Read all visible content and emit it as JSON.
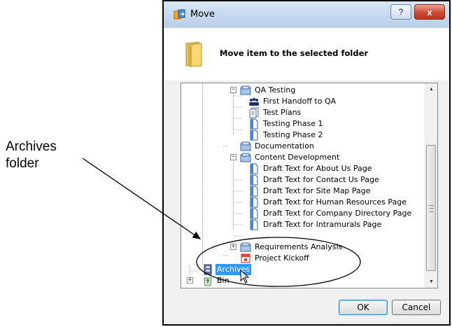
{
  "callout": {
    "line1": "Archives",
    "line2": "folder"
  },
  "dialog": {
    "title": "Move",
    "help_label": "?",
    "close_label": "x",
    "header": "Move item to the selected folder",
    "ok_label": "OK",
    "cancel_label": "Cancel"
  },
  "tree": {
    "nodes": [
      {
        "label": "QA Testing",
        "icon": "workspace-folder-icon"
      },
      {
        "label": "First Handoff to QA",
        "icon": "team-icon"
      },
      {
        "label": "Test Plans",
        "icon": "document-folder-icon"
      },
      {
        "label": "Testing Phase 1",
        "icon": "document-icon"
      },
      {
        "label": "Testing Phase 2",
        "icon": "document-icon"
      },
      {
        "label": "Documentation",
        "icon": "workspace-folder-icon"
      },
      {
        "label": "Content Development",
        "icon": "workspace-folder-icon"
      },
      {
        "label": "Draft Text for About Us Page",
        "icon": "document-icon"
      },
      {
        "label": "Draft Text for Contact Us Page",
        "icon": "document-icon"
      },
      {
        "label": "Draft Text for Site Map Page",
        "icon": "document-icon"
      },
      {
        "label": "Draft Text for Human Resources Page",
        "icon": "document-icon"
      },
      {
        "label": "Draft Text for Company Directory Page",
        "icon": "document-icon"
      },
      {
        "label": "Draft Text for Intramurals Page",
        "icon": "document-icon"
      },
      {
        "label": "Requirements Analysis",
        "icon": "workspace-folder-icon"
      },
      {
        "label": "Project Kickoff",
        "icon": "calendar-icon"
      },
      {
        "label": "Archives",
        "icon": "archive-cabinet-icon"
      },
      {
        "label": "Bin",
        "icon": "recycle-bin-icon"
      }
    ]
  },
  "colors": {
    "selection": "#3399ff",
    "titlebar": "#c5d9ee",
    "close_button": "#cd4b33"
  }
}
